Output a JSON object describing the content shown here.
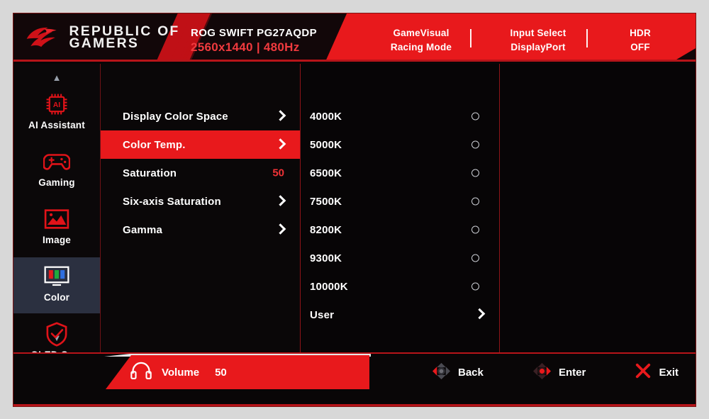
{
  "header": {
    "brand_line1": "REPUBLIC OF",
    "brand_line2": "GAMERS",
    "logo_icon": "rog-logo-icon",
    "model_name": "ROG SWIFT PG27AQDP",
    "model_resolution": "2560x1440  |  480Hz",
    "groups": [
      {
        "label": "GameVisual",
        "value": "Racing Mode"
      },
      {
        "label": "Input Select",
        "value": "DisplayPort"
      },
      {
        "label": "HDR",
        "value": "OFF"
      }
    ]
  },
  "sidebar": {
    "scroll_up_icon": "chevron-up-icon",
    "scroll_down_icon": "chevron-down-icon",
    "items": [
      {
        "label": "AI Assistant",
        "icon": "ai-chip-icon",
        "active": false
      },
      {
        "label": "Gaming",
        "icon": "gamepad-icon",
        "active": false
      },
      {
        "label": "Image",
        "icon": "picture-icon",
        "active": false
      },
      {
        "label": "Color",
        "icon": "color-monitor-icon",
        "active": true
      },
      {
        "label": "OLED Care",
        "icon": "shield-check-icon",
        "active": false
      }
    ]
  },
  "menu": {
    "items": [
      {
        "label": "Display Color Space",
        "control": "chevron",
        "value": "",
        "selected": false
      },
      {
        "label": "Color Temp.",
        "control": "chevron",
        "value": "",
        "selected": true
      },
      {
        "label": "Saturation",
        "control": "value",
        "value": "50",
        "selected": false
      },
      {
        "label": "Six-axis Saturation",
        "control": "chevron",
        "value": "",
        "selected": false
      },
      {
        "label": "Gamma",
        "control": "chevron",
        "value": "",
        "selected": false
      }
    ]
  },
  "options": {
    "items": [
      {
        "label": "4000K",
        "control": "radio",
        "checked": false
      },
      {
        "label": "5000K",
        "control": "radio",
        "checked": false
      },
      {
        "label": "6500K",
        "control": "radio",
        "checked": false
      },
      {
        "label": "7500K",
        "control": "radio",
        "checked": false
      },
      {
        "label": "8200K",
        "control": "radio",
        "checked": false
      },
      {
        "label": "9300K",
        "control": "radio",
        "checked": false
      },
      {
        "label": "10000K",
        "control": "radio",
        "checked": false
      },
      {
        "label": "User",
        "control": "chevron",
        "checked": false
      }
    ]
  },
  "footer": {
    "volume_icon": "headphone-icon",
    "volume_label": "Volume",
    "volume_value": "50",
    "actions": [
      {
        "label": "Back",
        "icon": "joystick-left-icon"
      },
      {
        "label": "Enter",
        "icon": "joystick-right-icon"
      },
      {
        "label": "Exit",
        "icon": "close-x-icon"
      }
    ]
  },
  "colors": {
    "accent_red": "#e8191c",
    "header_red": "#e8191c",
    "value_red": "#f03236",
    "active_sidebar": "#2b3040",
    "panel_black": "#0a0708"
  }
}
